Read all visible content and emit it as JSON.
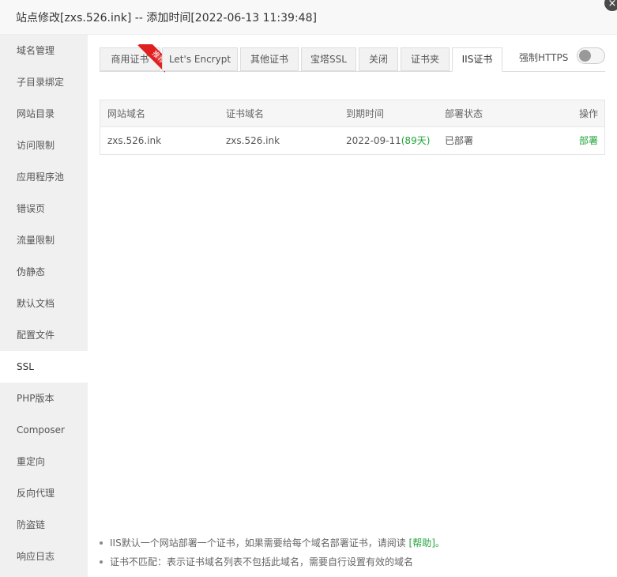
{
  "window": {
    "title": "站点修改[zxs.526.ink] -- 添加时间[2022-06-13 11:39:48]",
    "close_glyph": "×"
  },
  "sidebar": {
    "items": [
      {
        "label": "域名管理"
      },
      {
        "label": "子目录绑定"
      },
      {
        "label": "网站目录"
      },
      {
        "label": "访问限制"
      },
      {
        "label": "应用程序池"
      },
      {
        "label": "错误页"
      },
      {
        "label": "流量限制"
      },
      {
        "label": "伪静态"
      },
      {
        "label": "默认文档"
      },
      {
        "label": "配置文件"
      },
      {
        "label": "SSL",
        "active": true
      },
      {
        "label": "PHP版本"
      },
      {
        "label": "Composer"
      },
      {
        "label": "重定向"
      },
      {
        "label": "反向代理"
      },
      {
        "label": "防盗链"
      },
      {
        "label": "响应日志"
      }
    ]
  },
  "tabs": [
    {
      "label": "商用证书"
    },
    {
      "label": "Let's Encrypt"
    },
    {
      "label": "其他证书"
    },
    {
      "label": "宝塔SSL"
    },
    {
      "label": "关闭"
    },
    {
      "label": "证书夹"
    },
    {
      "label": "IIS证书",
      "active": true
    }
  ],
  "ribbon_label": "推荐",
  "force_https": {
    "label": "强制HTTPS",
    "enabled": false
  },
  "table": {
    "headers": [
      "网站域名",
      "证书域名",
      "到期时间",
      "部署状态",
      "操作"
    ],
    "rows": [
      {
        "site_domain": "zxs.526.ink",
        "cert_domain": "zxs.526.ink",
        "expiry": "2022-09-11",
        "days_left": "(89天)",
        "status": "已部署",
        "action": "部署"
      }
    ]
  },
  "notes": {
    "note1": "IIS默认一个网站部署一个证书，如果需要给每个域名部署证书，请阅读",
    "help_link": "[帮助]",
    "note1_end": "。",
    "note2": "证书不匹配：表示证书域名列表不包括此域名，需要自行设置有效的域名"
  },
  "colors": {
    "accent": "#20a53a",
    "ribbon": "#e02020"
  }
}
